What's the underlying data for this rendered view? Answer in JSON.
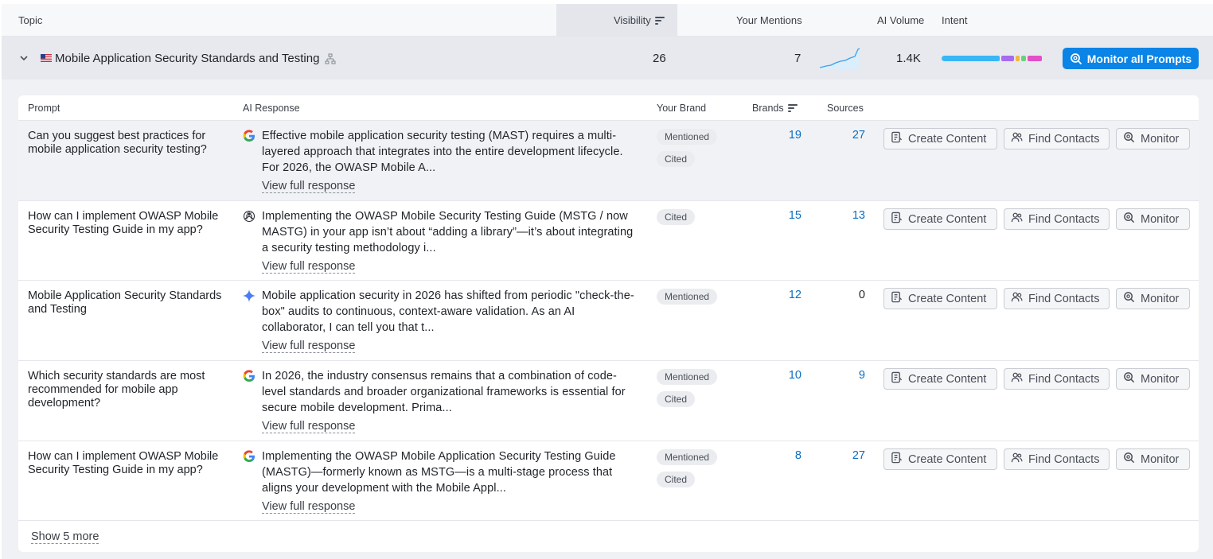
{
  "header": {
    "topic": "Topic",
    "visibility": "Visibility",
    "your_mentions": "Your Mentions",
    "ai_volume": "AI Volume",
    "intent": "Intent"
  },
  "topic_row": {
    "title": "Mobile Application Security Standards and Testing",
    "visibility": "26",
    "mentions": "7",
    "ai_volume": "1.4K",
    "intent_segments": [
      {
        "color": "#3ab6f5",
        "fraction": 0.62
      },
      {
        "color": "#a66bf0",
        "fraction": 0.13
      },
      {
        "color": "#f4b63a",
        "fraction": 0.05
      },
      {
        "color": "#6bcf7a",
        "fraction": 0.05
      },
      {
        "color": "#e34fc8",
        "fraction": 0.15
      }
    ],
    "monitor_all_label": "Monitor all Prompts"
  },
  "table": {
    "col_prompt": "Prompt",
    "col_response": "AI Response",
    "col_brand": "Your Brand",
    "col_brands": "Brands",
    "col_sources": "Sources"
  },
  "actions": {
    "create": "Create Content",
    "find": "Find Contacts",
    "monitor": "Monitor"
  },
  "rows": [
    {
      "prompt": "Can you suggest best practices for mobile application security testing?",
      "engine": "google-icon",
      "response": "Effective mobile application security testing (MAST) requires a multi-layered approach that integrates into the entire development lifecycle. For 2026, the OWASP Mobile A...",
      "view": "View full response",
      "badges": [
        "Mentioned",
        "Cited"
      ],
      "brands": "19",
      "sources": "27"
    },
    {
      "prompt": "How can I implement OWASP Mobile Security Testing Guide in my app?",
      "engine": "chatgpt-icon",
      "response": "Implementing the OWASP Mobile Security Testing Guide (MSTG / now MASTG) in your app isn’t about “adding a library”—it’s about integrating a security testing methodology i...",
      "view": "View full response",
      "badges": [
        "Cited"
      ],
      "brands": "15",
      "sources": "13"
    },
    {
      "prompt": "Mobile Application Security Standards and Testing",
      "engine": "gemini-icon",
      "response": "Mobile application security in 2026 has shifted from periodic \"check-the-box\" audits to continuous, context-aware validation. As an AI collaborator, I can tell you that t...",
      "view": "View full response",
      "badges": [
        "Mentioned"
      ],
      "brands": "12",
      "sources": "0"
    },
    {
      "prompt": "Which security standards are most recommended for mobile app development?",
      "engine": "google-icon",
      "response": "In 2026, the industry consensus remains that a combination of code-level standards and broader organizational frameworks is essential for secure mobile development. Prima...",
      "view": "View full response",
      "badges": [
        "Mentioned",
        "Cited"
      ],
      "brands": "10",
      "sources": "9"
    },
    {
      "prompt": "How can I implement OWASP Mobile Security Testing Guide in my app?",
      "engine": "google-icon",
      "response": "Implementing the OWASP Mobile Application Security Testing Guide (MASTG)—formerly known as MSTG—is a multi-stage process that aligns your development with the Mobile Appl...",
      "view": "View full response",
      "badges": [
        "Mentioned",
        "Cited"
      ],
      "brands": "8",
      "sources": "27"
    }
  ],
  "show_more": "Show 5 more"
}
